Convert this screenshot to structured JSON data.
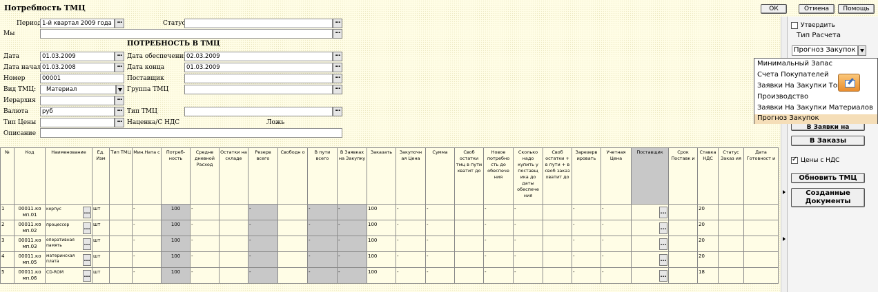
{
  "app": {
    "title": "Потребность ТМЦ"
  },
  "toolbar": {
    "ok_label": "ОК",
    "cancel_label": "Отмена",
    "help_label": "Помощь"
  },
  "form": {
    "section_title": "ПОТРЕБНОСТЬ В ТМЦ",
    "period": {
      "label": "Период",
      "value": "1-й квартал 2009 года"
    },
    "status": {
      "label": "Статус",
      "value": ""
    },
    "we": {
      "label": "Мы",
      "value": ""
    },
    "date": {
      "label": "Дата",
      "value": "01.03.2009"
    },
    "provision_date": {
      "label": "Дата обеспечения",
      "value": "02.03.2009"
    },
    "start_date": {
      "label": "Дата начала",
      "value": "01.03.2008"
    },
    "end_date": {
      "label": "Дата конца",
      "value": "01.03.2009"
    },
    "number": {
      "label": "Номер",
      "value": "00001"
    },
    "supplier": {
      "label": "Поставщик",
      "value": ""
    },
    "tmc_kind": {
      "label": "Вид ТМЦ:",
      "value": "Материал"
    },
    "tmc_group": {
      "label": "Группа ТМЦ",
      "value": ""
    },
    "hierarchy": {
      "label": "Иерархия",
      "value": ""
    },
    "currency": {
      "label": "Валюта",
      "value": "руб"
    },
    "tmc_type": {
      "label": "Тип ТМЦ",
      "value": ""
    },
    "price_type": {
      "label": "Тип Цены",
      "value": ""
    },
    "markup": {
      "label": "Наценка/С НДС",
      "value": "Ложь"
    },
    "description": {
      "label": "Описание",
      "value": ""
    }
  },
  "grid": {
    "columns": [
      "№",
      "Код",
      "Наименование",
      "Ед. Изм",
      "Тип ТМЦ",
      "Мин.Ната с",
      "Потреб- ность",
      "Средне дневной Расход",
      "Остатки на складе",
      "Резерв всего",
      "Свободн о",
      "В пути всего",
      "В Заявках на Закупку",
      "Заказать",
      "Закупочн ая Цена",
      "Сумма",
      "Своб остатки тмц в пути хватит до",
      "Новое потребно сть до обеспече ния",
      "Сколько надо купить у поставщ ика до даты обеспече ния",
      "Своб остатки + в пути + в своб заказ хватит до",
      "Зарезерв ировать",
      "Учетная Цена",
      "Поставщик",
      "Срок Поставк и",
      "Ставка НДС",
      "Статус Заказ ия",
      "Дата Готовност и"
    ],
    "rows": [
      {
        "n": "1",
        "code": "00011.ко мп.01",
        "name": "корпус",
        "unit": "шт",
        "minnat": "-",
        "need": "100",
        "avg": "-",
        "reserve": "-",
        "inpath": "-",
        "requests": "-",
        "order": "100",
        "price": "-",
        "sum": "-",
        "free": "-",
        "newneed": "-",
        "buy": "-",
        "reserve2": "-",
        "acc": "-",
        "vat": "20"
      },
      {
        "n": "2",
        "code": "00011.ко мп.02",
        "name": "процессор",
        "unit": "шт",
        "minnat": "-",
        "need": "100",
        "avg": "-",
        "reserve": "-",
        "inpath": "-",
        "requests": "-",
        "order": "100",
        "price": "-",
        "sum": "-",
        "free": "-",
        "newneed": "-",
        "buy": "-",
        "reserve2": "-",
        "acc": "-",
        "vat": "20"
      },
      {
        "n": "3",
        "code": "00011.ко мп.03",
        "name": "оперативная память",
        "unit": "шт",
        "minnat": "-",
        "need": "100",
        "avg": "-",
        "reserve": "-",
        "inpath": "-",
        "requests": "-",
        "order": "100",
        "price": "-",
        "sum": "-",
        "free": "-",
        "newneed": "-",
        "buy": "-",
        "reserve2": "-",
        "acc": "-",
        "vat": "20"
      },
      {
        "n": "4",
        "code": "00011.ко мп.05",
        "name": "материнская плата",
        "unit": "шт",
        "minnat": "-",
        "need": "100",
        "avg": "-",
        "reserve": "-",
        "inpath": "-",
        "requests": "-",
        "order": "100",
        "price": "-",
        "sum": "-",
        "free": "-",
        "newneed": "-",
        "buy": "-",
        "reserve2": "-",
        "acc": "-",
        "vat": "20"
      },
      {
        "n": "5",
        "code": "00011.ко мп.06",
        "name": "CD-ROM",
        "unit": "шт",
        "minnat": "-",
        "need": "100",
        "avg": "-",
        "reserve": "-",
        "inpath": "-",
        "requests": "-",
        "order": "100",
        "price": "-",
        "sum": "-",
        "free": "-",
        "newneed": "-",
        "buy": "-",
        "reserve2": "-",
        "acc": "-",
        "vat": "18"
      }
    ]
  },
  "side": {
    "approve_label": "Утвердить",
    "calc_type_label": "Тип Расчета",
    "calc_type_value": "Прогноз Закупок",
    "options": [
      "Минимальный Запас",
      "Счета Покупателей",
      "Заявки На Закупки Тов",
      "Производство",
      "Заявки На Закупки Материалов",
      "Прогноз Закупок"
    ],
    "highlighted_index": 5,
    "to_requests_label": "В Заявки на Закупки",
    "to_orders_label": "В Заказы",
    "vat_prices_label": "Цены с НДС",
    "refresh_label": "Обновить ТМЦ",
    "created_docs_label": "Созданные Документы"
  },
  "colors": {
    "background": "#fffde6",
    "selected_column": "#c8c8c8",
    "highlight": "#f5deb8",
    "edit_icon": "#f2a24a"
  }
}
